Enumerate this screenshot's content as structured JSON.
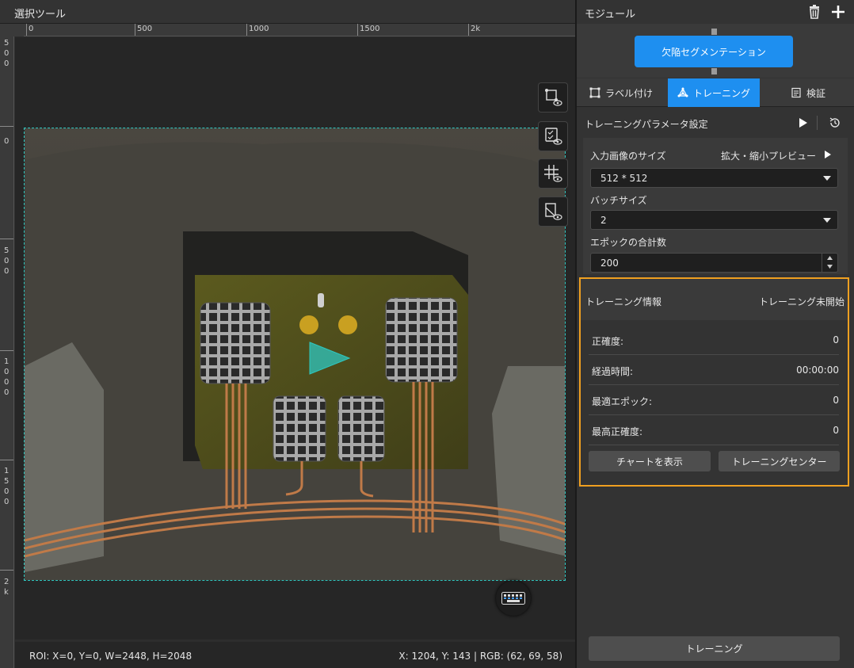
{
  "left_panel": {
    "title": "選択ツール"
  },
  "ruler": {
    "h_labels": [
      "0",
      "500",
      "1000",
      "1500",
      "2k"
    ],
    "v_labels": [
      "5\n0\n0",
      "0",
      "5\n0\n0",
      "1\n0\n0\n0",
      "1\n5\n0\n0",
      "2\nk"
    ]
  },
  "status": {
    "roi": "ROI: X=0, Y=0, W=2448, H=2048",
    "cursor": "X: 1204, Y: 143 | RGB: (62, 69, 58)"
  },
  "module": {
    "title": "モジュール",
    "node_label": "欠陥セグメンテーション"
  },
  "tabs": [
    {
      "label": "ラベル付け",
      "active": false
    },
    {
      "label": "トレーニング",
      "active": true
    },
    {
      "label": "検証",
      "active": false
    }
  ],
  "params": {
    "title": "トレーニングパラメータ設定",
    "input_size_label": "入力画像のサイズ",
    "zoom_preview_label": "拡大・縮小プレビュー",
    "input_size_value": "512 * 512",
    "batch_label": "バッチサイズ",
    "batch_value": "2",
    "epoch_label": "エポックの合計数",
    "epoch_value": "200"
  },
  "info": {
    "title": "トレーニング情報",
    "status": "トレーニング未開始",
    "rows": [
      {
        "label": "正確度:",
        "value": "0"
      },
      {
        "label": "経過時間:",
        "value": "00:00:00"
      },
      {
        "label": "最適エポック:",
        "value": "0"
      },
      {
        "label": "最高正確度:",
        "value": "0"
      }
    ],
    "chart_button": "チャートを表示",
    "center_button": "トレーニングセンター"
  },
  "train_button": "トレーニング",
  "colors": {
    "accent": "#1e8ff0",
    "highlight_border": "#f0a020",
    "roi_border": "#2ec7c0"
  }
}
